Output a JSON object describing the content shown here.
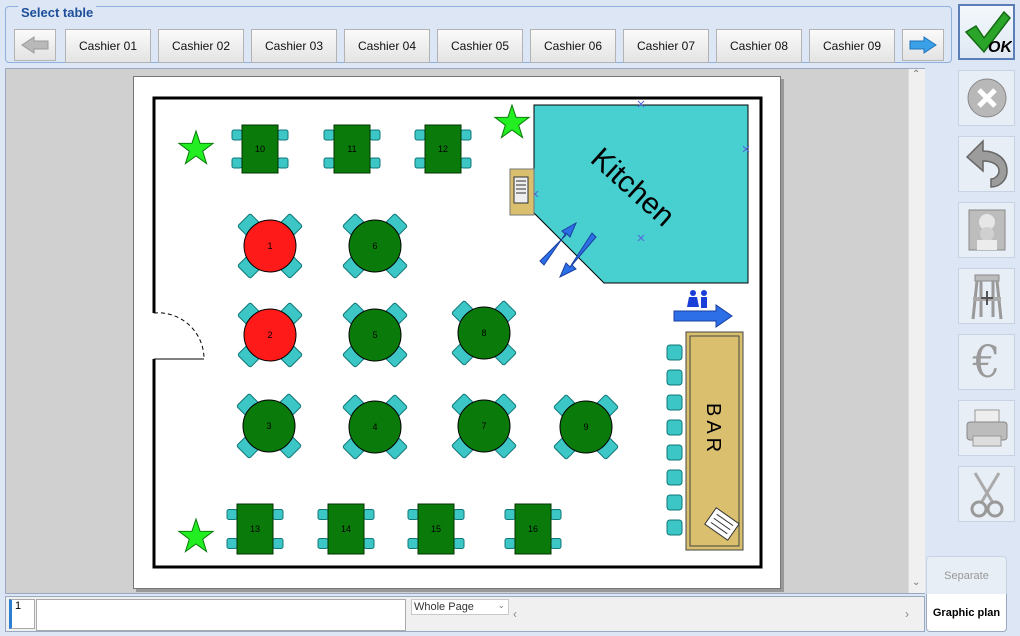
{
  "select_table": {
    "title": "Select table",
    "cashiers": [
      "Cashier 01",
      "Cashier 02",
      "Cashier 03",
      "Cashier 04",
      "Cashier 05",
      "Cashier 06",
      "Cashier 07",
      "Cashier 08",
      "Cashier 09"
    ]
  },
  "toolbar": {
    "ok_label": "OK",
    "tools": [
      "cancel-icon",
      "undo-icon",
      "chef-icon",
      "high-chair-icon",
      "euro-icon",
      "printer-icon",
      "scissors-icon"
    ]
  },
  "floor_plan": {
    "kitchen_label": "Kitchen",
    "bar_label": "BAR",
    "tables_top": [
      "10",
      "11",
      "12"
    ],
    "tables_bottom": [
      "13",
      "14",
      "15",
      "16"
    ],
    "round_tables": [
      {
        "label": "1",
        "status": "occupied"
      },
      {
        "label": "6",
        "status": "free"
      },
      {
        "label": "2",
        "status": "occupied"
      },
      {
        "label": "5",
        "status": "free"
      },
      {
        "label": "8",
        "status": "free"
      },
      {
        "label": "3",
        "status": "free"
      },
      {
        "label": "4",
        "status": "free"
      },
      {
        "label": "7",
        "status": "free"
      },
      {
        "label": "9",
        "status": "free"
      }
    ],
    "colors": {
      "free": "#0a7a0a",
      "occupied": "#ff1a1a",
      "chair": "#3cc6c6",
      "kitchen": "#48cfcf",
      "bar": "#d9bf6e",
      "plant": "#22ee22"
    }
  },
  "bottom_bar": {
    "page_number": "1",
    "zoom_value": "Whole Page"
  },
  "tabs": {
    "separate": "Separate",
    "graphic_plan": "Graphic plan"
  }
}
